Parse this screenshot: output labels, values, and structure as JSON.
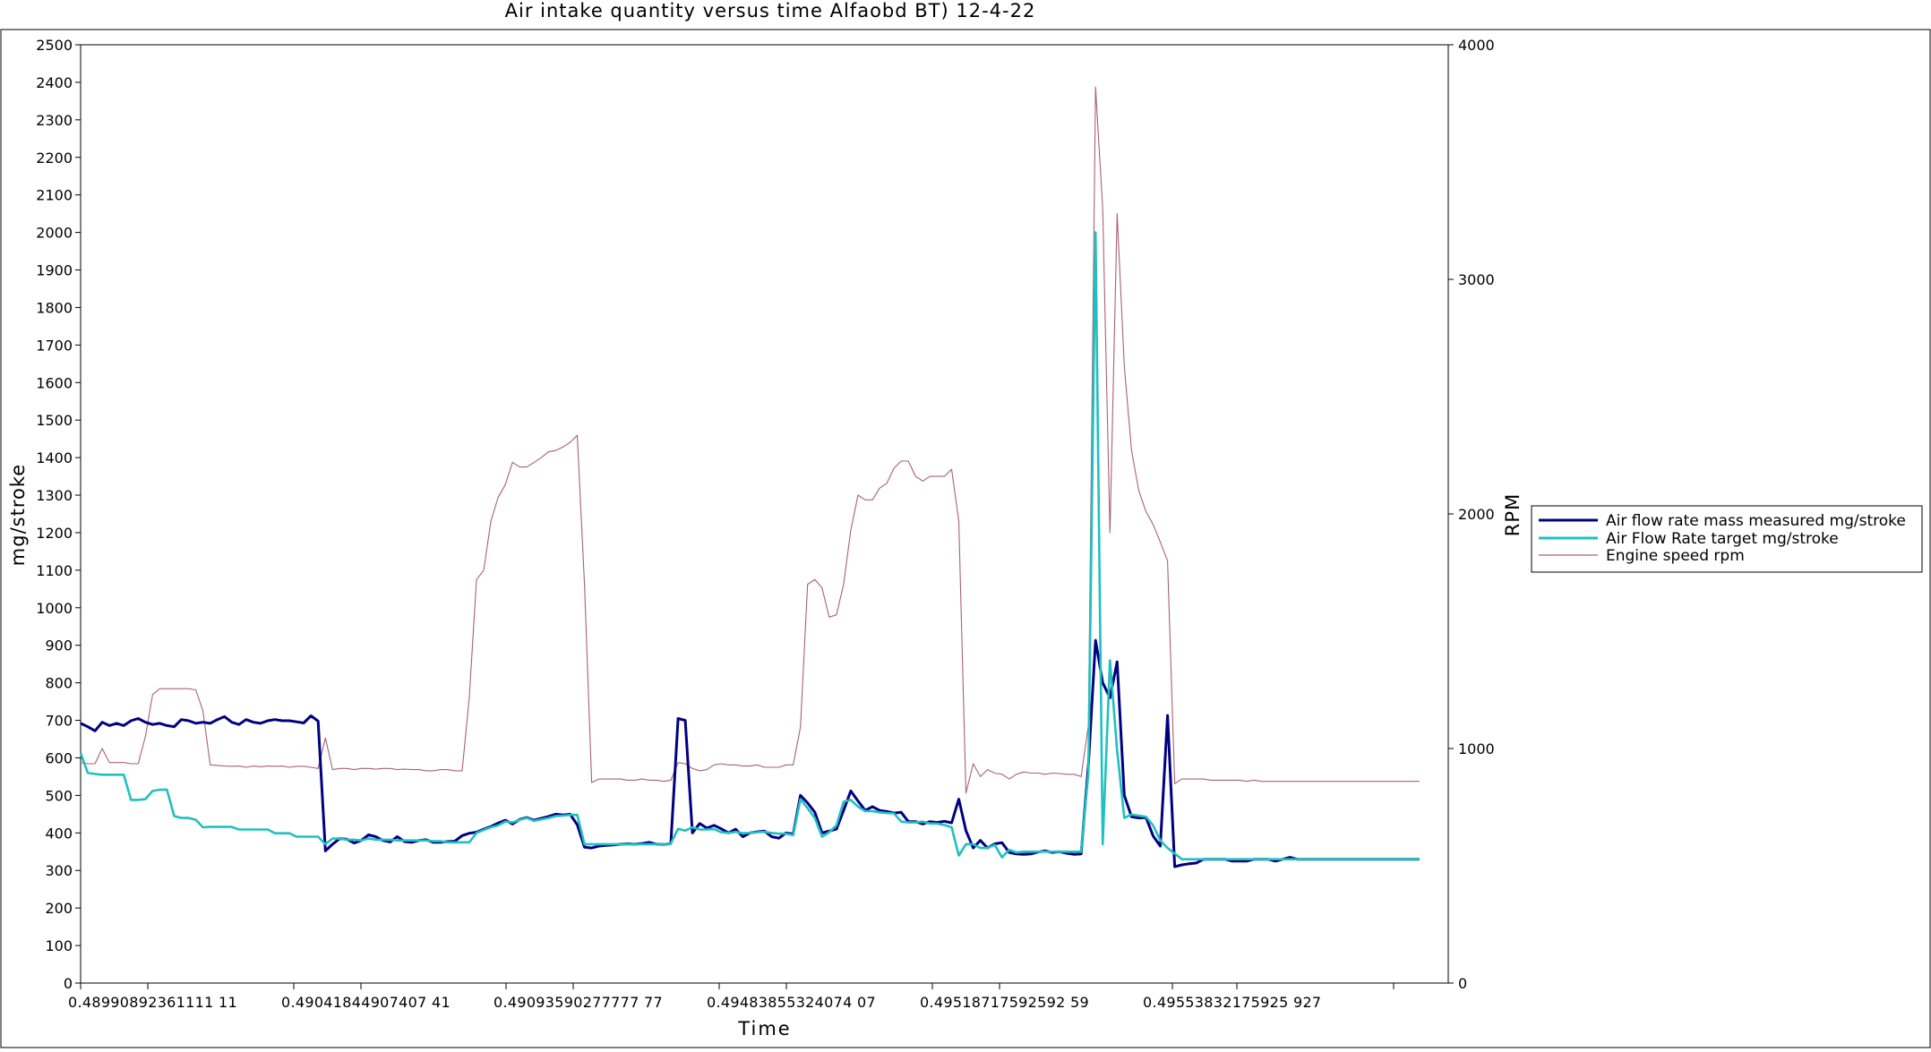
{
  "chart_data": {
    "type": "line",
    "title": "Air intake quantity versus time Alfaobd BT) 12-4-22",
    "xlabel": "Time",
    "ylabel": "mg/stroke",
    "y2label": "RPM",
    "ylim": [
      0,
      2500
    ],
    "y2lim": [
      0,
      4000
    ],
    "yticks": [
      "0",
      "100",
      "200",
      "300",
      "400",
      "500",
      "600",
      "700",
      "800",
      "900",
      "1000",
      "1100",
      "1200",
      "1300",
      "1400",
      "1500",
      "1600",
      "1700",
      "1800",
      "1900",
      "2000",
      "2100",
      "2200",
      "2300",
      "2400",
      "2500"
    ],
    "y2ticks": [
      "0",
      "1000",
      "2000",
      "3000",
      "4000"
    ],
    "xtick_labels": [
      "0.48990892361111 11",
      "0.49041844907407 41",
      "0.49093590277777 77",
      "0.49483855324074 07",
      "0.49518717592592 59",
      "0.49553832175925 927"
    ],
    "x_sample_count": 191,
    "legend_position": "right",
    "grid": false,
    "series": [
      {
        "name": "Air flow rate mass measured mg/stroke",
        "axis": "left",
        "color": "#000080",
        "values": [
          692,
          683,
          672,
          695,
          686,
          692,
          686,
          699,
          705,
          695,
          689,
          692,
          686,
          683,
          702,
          699,
          692,
          695,
          692,
          702,
          710,
          695,
          689,
          702,
          695,
          692,
          699,
          702,
          699,
          699,
          696,
          693,
          712,
          698,
          352,
          370,
          385,
          383,
          373,
          380,
          395,
          390,
          380,
          376,
          390,
          377,
          375,
          380,
          382,
          375,
          375,
          377,
          378,
          393,
          399,
          402,
          410,
          417,
          426,
          434,
          424,
          436,
          441,
          434,
          439,
          444,
          450,
          448,
          450,
          422,
          362,
          360,
          365,
          367,
          368,
          370,
          371,
          370,
          372,
          375,
          370,
          369,
          372,
          705,
          700,
          400,
          425,
          413,
          420,
          411,
          400,
          410,
          390,
          400,
          403,
          405,
          390,
          386,
          400,
          397,
          500,
          480,
          455,
          400,
          405,
          410,
          460,
          512,
          485,
          460,
          470,
          460,
          457,
          453,
          455,
          430,
          430,
          424,
          430,
          428,
          431,
          427,
          490,
          406,
          360,
          380,
          360,
          371,
          374,
          348,
          344,
          343,
          344,
          349,
          352,
          348,
          350,
          346,
          343,
          344,
          580,
          913,
          800,
          760,
          856,
          500,
          443,
          440,
          441,
          392,
          365,
          713,
          310,
          315,
          318,
          320,
          330,
          330,
          330,
          330,
          325,
          325,
          325,
          330,
          330,
          330,
          325
        ],
        "values_tail": [
          330,
          335,
          330,
          330,
          330,
          330,
          330,
          330,
          330,
          330,
          330,
          330,
          330,
          330,
          330,
          330,
          330,
          330,
          330,
          330
        ]
      },
      {
        "name": "Air Flow Rate target mg/stroke",
        "axis": "left",
        "color": "#20c0c0",
        "values": [
          613,
          560,
          557,
          555,
          555,
          555,
          555,
          488,
          488,
          490,
          512,
          515,
          515,
          445,
          440,
          440,
          435,
          415,
          416,
          416,
          416,
          416,
          409,
          409,
          409,
          409,
          409,
          399,
          399,
          399,
          390,
          390,
          390,
          390,
          370,
          385,
          385,
          382,
          382,
          380,
          385,
          382,
          382,
          382,
          380,
          380,
          380,
          380,
          380,
          378,
          378,
          375,
          375,
          375,
          375,
          400,
          408,
          415,
          420,
          430,
          428,
          435,
          440,
          432,
          436,
          440,
          445,
          446,
          448,
          448,
          370,
          370,
          370,
          370,
          370,
          370,
          370,
          370,
          370,
          370,
          370,
          369,
          372,
          411,
          406,
          415,
          409,
          409,
          410,
          402,
          400,
          403,
          399,
          400,
          402,
          403,
          400,
          398,
          398,
          394,
          490,
          466,
          440,
          390,
          402,
          420,
          483,
          488,
          470,
          458,
          458,
          455,
          453,
          452,
          430,
          428,
          428,
          430,
          425,
          425,
          421,
          415,
          340,
          370,
          370,
          360,
          360,
          368,
          335,
          355,
          348,
          350,
          350,
          350,
          350,
          350,
          350,
          350,
          350,
          350,
          560,
          2000,
          370,
          860,
          620,
          440,
          449,
          446,
          443,
          420,
          380,
          360,
          345,
          330,
          330,
          330,
          330,
          330,
          330,
          330,
          330,
          330,
          330,
          330,
          330,
          330,
          330
        ],
        "values_tail": [
          330,
          330,
          330,
          330,
          330,
          330,
          330,
          330,
          330,
          330,
          330,
          330,
          330,
          330,
          330,
          330,
          330,
          330,
          330,
          330
        ]
      },
      {
        "name": "Engine speed rpm",
        "axis": "right",
        "color": "#a8607a",
        "values": [
          940,
          935,
          935,
          1000,
          940,
          940,
          940,
          935,
          935,
          1050,
          1230,
          1255,
          1255,
          1255,
          1255,
          1255,
          1250,
          1160,
          930,
          928,
          925,
          924,
          925,
          920,
          925,
          922,
          925,
          924,
          925,
          920,
          924,
          924,
          920,
          915,
          1045,
          910,
          915,
          915,
          910,
          915,
          915,
          912,
          915,
          915,
          910,
          912,
          910,
          910,
          905,
          905,
          910,
          910,
          905,
          905,
          1220,
          1720,
          1760,
          1970,
          2070,
          2125,
          2220,
          2200,
          2200,
          2220,
          2240,
          2265,
          2270,
          2285,
          2305,
          2335,
          1700,
          855,
          870,
          870,
          870,
          870,
          865,
          865,
          870,
          865,
          865,
          860,
          865,
          940,
          935,
          915,
          905,
          910,
          930,
          935,
          930,
          930,
          925,
          925,
          930,
          920,
          920,
          920,
          930,
          930,
          1090,
          1700,
          1720,
          1685,
          1560,
          1570,
          1700,
          1930,
          2080,
          2060,
          2060,
          2110,
          2130,
          2195,
          2225,
          2225,
          2160,
          2140,
          2160,
          2160,
          2160,
          2190,
          1970,
          810,
          935,
          880,
          910,
          895,
          890,
          870,
          890,
          900,
          895,
          895,
          890,
          895,
          893,
          890,
          890,
          880,
          1100,
          3820,
          3300,
          1920,
          3280,
          2630,
          2270,
          2100,
          2010,
          1955,
          1880,
          1800,
          850,
          870,
          870,
          870,
          870,
          865,
          865,
          865,
          865,
          865,
          860,
          865,
          860,
          860,
          860
        ],
        "values_tail": [
          860,
          860,
          860,
          860,
          860,
          860,
          860,
          860,
          860,
          860,
          860,
          860,
          860,
          860,
          860,
          860,
          860,
          860,
          860,
          860
        ]
      }
    ]
  }
}
